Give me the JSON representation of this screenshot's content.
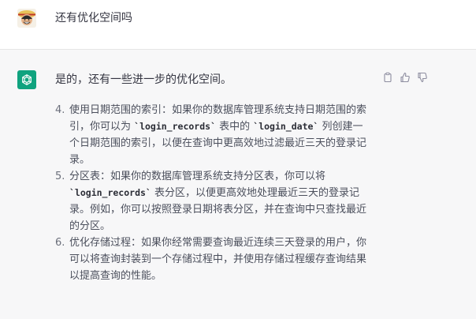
{
  "user_message": {
    "avatar_icon": "user-avatar-icon",
    "text": "还有优化空间吗"
  },
  "assistant_message": {
    "avatar_icon": "chatgpt-logo-icon",
    "intro": "是的，还有一些进一步的优化空间。",
    "actions": [
      {
        "name": "copy",
        "icon": "clipboard-icon"
      },
      {
        "name": "thumbs-up",
        "icon": "thumbs-up-icon"
      },
      {
        "name": "thumbs-down",
        "icon": "thumbs-down-icon"
      }
    ],
    "items": [
      {
        "num": "4.",
        "t1": "使用日期范围的索引：如果你的数据库管理系统支持日期范围的索引，你可以为 ",
        "c1": "`login_records`",
        "t2": " 表中的 ",
        "c2": "`login_date`",
        "t3": " 列创建一个日期范围的索引，以便在查询中更高效地过滤最近三天的登录记录。"
      },
      {
        "num": "5.",
        "t1": "分区表：如果你的数据库管理系统支持分区表，你可以将 ",
        "c1": "`login_records`",
        "t2": " 表分区，以便更高效地处理最近三天的登录记录。例如，你可以按照登录日期将表分区，并在查询中只查找最近的分区。"
      },
      {
        "num": "6.",
        "t1": "优化存储过程：如果你经常需要查询最近连续三天登录的用户，你可以将查询封装到一个存储过程中，并使用存储过程缓存查询结果以提高查询的性能。"
      }
    ]
  },
  "colors": {
    "accent": "#10a37f",
    "assistant_bg": "#f7f7f8",
    "user_bg": "#ffffff"
  }
}
